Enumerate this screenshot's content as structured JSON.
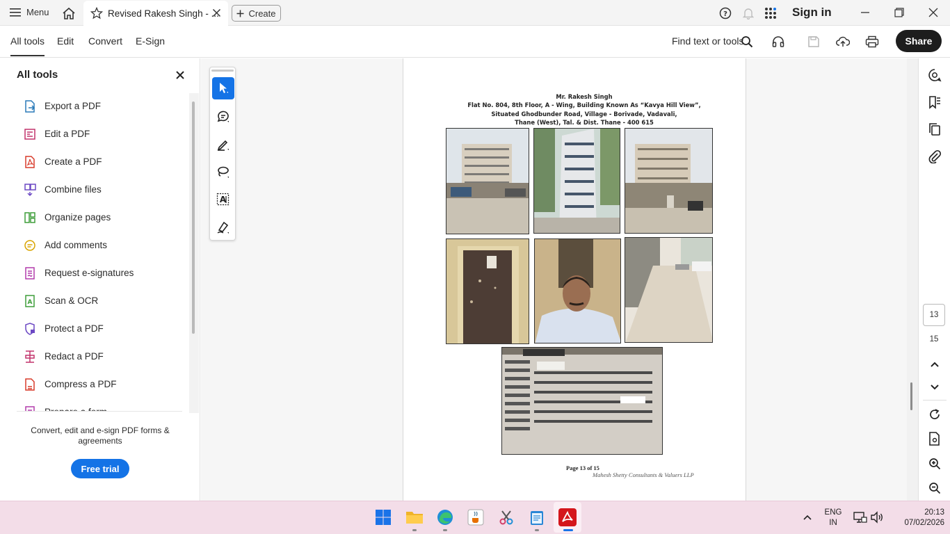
{
  "titlebar": {
    "menu_label": "Menu",
    "tab_title": "Revised Rakesh Singh - ...",
    "create_label": "Create",
    "signin_label": "Sign in"
  },
  "toolbar": {
    "tabs": [
      "All tools",
      "Edit",
      "Convert",
      "E-Sign"
    ],
    "find_label": "Find text or tools",
    "share_label": "Share"
  },
  "left_panel": {
    "title": "All tools",
    "items": [
      {
        "label": "Export a PDF",
        "icon": "export-pdf-icon",
        "color": "#2a7ab8"
      },
      {
        "label": "Edit a PDF",
        "icon": "edit-pdf-icon",
        "color": "#c2326b"
      },
      {
        "label": "Create a PDF",
        "icon": "create-pdf-icon",
        "color": "#d83b2b"
      },
      {
        "label": "Combine files",
        "icon": "combine-files-icon",
        "color": "#6c49c4"
      },
      {
        "label": "Organize pages",
        "icon": "organize-pages-icon",
        "color": "#3f9e3a"
      },
      {
        "label": "Add comments",
        "icon": "add-comments-icon",
        "color": "#d9a400"
      },
      {
        "label": "Request e-signatures",
        "icon": "request-esign-icon",
        "color": "#b23bab"
      },
      {
        "label": "Scan & OCR",
        "icon": "scan-ocr-icon",
        "color": "#3f9e3a"
      },
      {
        "label": "Protect a PDF",
        "icon": "protect-pdf-icon",
        "color": "#6c49c4"
      },
      {
        "label": "Redact a PDF",
        "icon": "redact-pdf-icon",
        "color": "#c2326b"
      },
      {
        "label": "Compress a PDF",
        "icon": "compress-pdf-icon",
        "color": "#d83b2b"
      },
      {
        "label": "Prepare a form",
        "icon": "prepare-form-icon",
        "color": "#b23bab"
      }
    ],
    "promo_text": "Convert, edit and e-sign PDF forms & agreements",
    "free_trial_label": "Free trial"
  },
  "document": {
    "address_lines": [
      "Mr. Rakesh Singh",
      "Flat No. 804, 8th Floor, A - Wing, Building Known As “Kavya Hill View”,",
      "Situated Ghodbunder Road, Village - Borivade, Vadavali,",
      "Thane (West), Tal. & Dist. Thane - 400 615"
    ],
    "photos": [
      "building-front-photo",
      "building-tower-photo",
      "building-side-photo",
      "flat-door-photo",
      "engineer-selfie-photo",
      "compound-road-photo",
      "electric-meters-photo"
    ],
    "page_footer": "Page 13 of 15",
    "signature_text": "Mahesh Shetty Consultants & Valuers LLP"
  },
  "page_nav": {
    "current_page": "13",
    "total_pages": "15"
  },
  "taskbar": {
    "lang_line1": "ENG",
    "lang_line2": "IN",
    "time": "20:13",
    "date": "07/02/2026"
  }
}
